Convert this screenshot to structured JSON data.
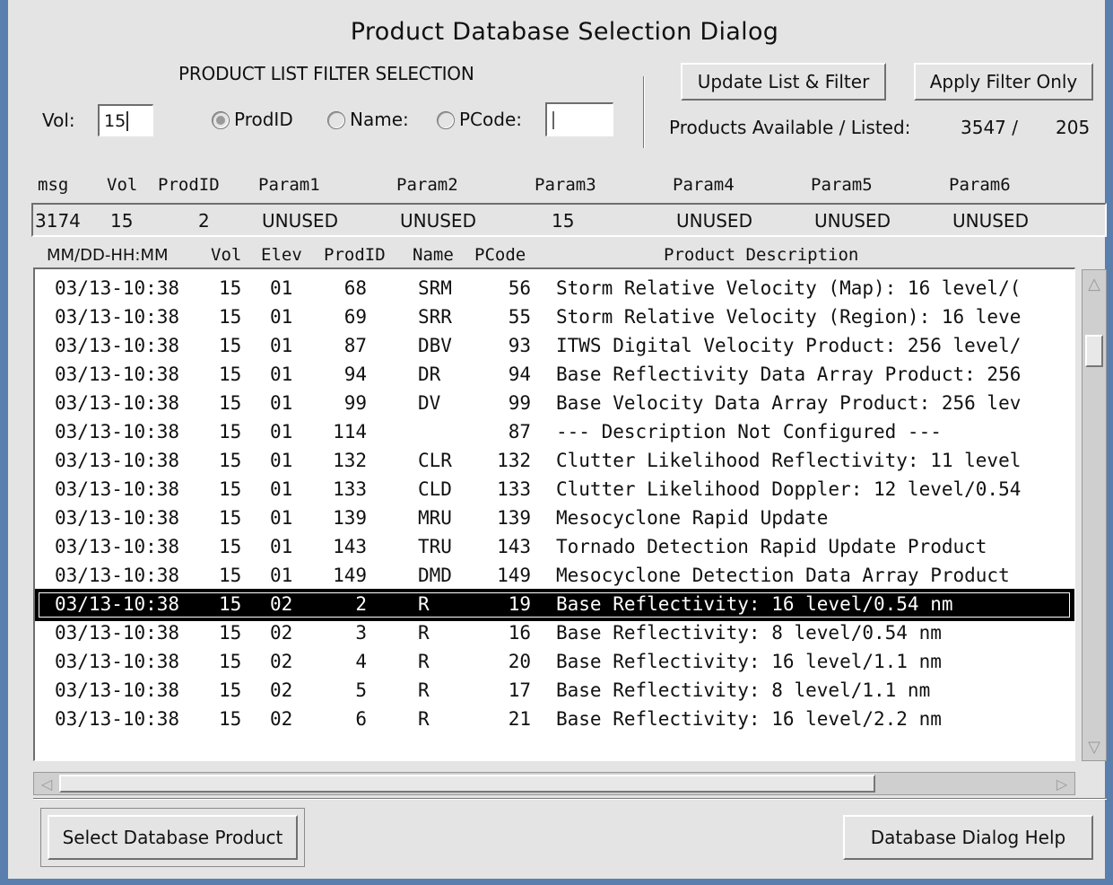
{
  "window": {
    "title": "Product Database Selection Dialog"
  },
  "filter": {
    "section_label": "PRODUCT LIST FILTER SELECTION",
    "vol_label": "Vol:",
    "vol_value": "15",
    "radio_prodid": "ProdID",
    "radio_name": "Name:",
    "radio_pcode": "PCode:",
    "pcode_value": "",
    "selected_radio": "ProdID"
  },
  "buttons": {
    "update": "Update List & Filter",
    "apply": "Apply Filter Only",
    "select": "Select Database Product",
    "help": "Database Dialog Help"
  },
  "products": {
    "label": "Products  Available / Listed:",
    "available": "3547 /",
    "listed": "205"
  },
  "param_header": [
    "msg",
    "Vol",
    "ProdID",
    "Param1",
    "Param2",
    "Param3",
    "Param4",
    "Param5",
    "Param6"
  ],
  "param_values": [
    "3174",
    "15",
    "2",
    "UNUSED",
    "UNUSED",
    "15",
    "UNUSED",
    "UNUSED",
    "UNUSED"
  ],
  "list_header": [
    "MM/DD-HH:MM",
    "Vol",
    "Elev",
    "ProdID",
    "Name",
    "PCode",
    "Product Description"
  ],
  "rows": [
    [
      "03/13-10:38",
      "15",
      "01",
      "68",
      "SRM",
      "56",
      "Storm Relative Velocity (Map): 16 level/("
    ],
    [
      "03/13-10:38",
      "15",
      "01",
      "69",
      "SRR",
      "55",
      "Storm Relative Velocity (Region): 16 leve"
    ],
    [
      "03/13-10:38",
      "15",
      "01",
      "87",
      "DBV",
      "93",
      "ITWS Digital Velocity Product: 256 level/"
    ],
    [
      "03/13-10:38",
      "15",
      "01",
      "94",
      "DR",
      "94",
      "Base Reflectivity Data Array Product: 256"
    ],
    [
      "03/13-10:38",
      "15",
      "01",
      "99",
      "DV",
      "99",
      "Base Velocity Data Array Product: 256 lev"
    ],
    [
      "03/13-10:38",
      "15",
      "01",
      "114",
      "",
      "87",
      "--- Description Not Configured ---"
    ],
    [
      "03/13-10:38",
      "15",
      "01",
      "132",
      "CLR",
      "132",
      "Clutter Likelihood Reflectivity: 11 level"
    ],
    [
      "03/13-10:38",
      "15",
      "01",
      "133",
      "CLD",
      "133",
      "Clutter Likelihood Doppler: 12 level/0.54"
    ],
    [
      "03/13-10:38",
      "15",
      "01",
      "139",
      "MRU",
      "139",
      "Mesocyclone Rapid Update"
    ],
    [
      "03/13-10:38",
      "15",
      "01",
      "143",
      "TRU",
      "143",
      "Tornado Detection Rapid Update Product"
    ],
    [
      "03/13-10:38",
      "15",
      "01",
      "149",
      "DMD",
      "149",
      "Mesocyclone Detection Data Array Product"
    ],
    [
      "03/13-10:38",
      "15",
      "02",
      "2",
      "R",
      "19",
      "Base Reflectivity: 16 level/0.54 nm"
    ],
    [
      "03/13-10:38",
      "15",
      "02",
      "3",
      "R",
      "16",
      "Base Reflectivity: 8 level/0.54 nm"
    ],
    [
      "03/13-10:38",
      "15",
      "02",
      "4",
      "R",
      "20",
      "Base Reflectivity: 16 level/1.1 nm"
    ],
    [
      "03/13-10:38",
      "15",
      "02",
      "5",
      "R",
      "17",
      "Base Reflectivity: 8 level/1.1 nm"
    ],
    [
      "03/13-10:38",
      "15",
      "02",
      "6",
      "R",
      "21",
      "Base Reflectivity: 16 level/2.2 nm"
    ]
  ],
  "selected_row": 11,
  "icons": {
    "scroll_up": "triangle-up-icon",
    "scroll_down": "triangle-down-icon",
    "scroll_left": "triangle-left-icon",
    "scroll_right": "triangle-right-icon"
  }
}
